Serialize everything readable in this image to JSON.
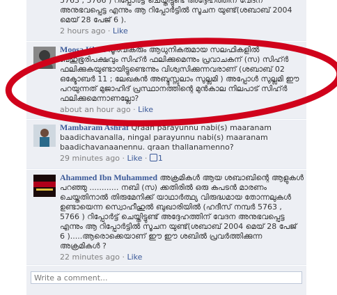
{
  "comments": [
    {
      "author": "",
      "text": "5763 , 5766 ) റിപ്പോർട്ട് ചെയ്തിട്ടുണ്ട് അദ്ദേഹത്തിന് വേദന അനുഭവപ്പെട്ട എന്നും ആ റിപ്പോർട്ടിൽ സൂചന യുണ്ട്(ശബാബ് 2004 മെയ് 28 പേജ് 6 ).",
      "time": "2 hours ago",
      "like_label": "Like"
    },
    {
      "author": "Moosa Khan",
      "text": "പൂർവികരും ആധുനികരുമായ സലഫികളിൽ ബഹുഭൂരിപക്ഷവും സിഹ്ർ ഫലിക്കുമെന്നും പ്രവാചകന് (സ) സിഹ്ർ ഫലിക്കുകയുണ്ടായിട്ടുണ്ടെന്നും വിശ്വസിക്കുന്നവരാണ് (ശബാബ് 02 ഒക്ടോബർ 11 ; ലേഖകൻ അബ്ദുസ്സലാം സുല്ലമി ) അപ്പോൾ സുല്ലമി ഈ പറയുന്നത് മുജാഹിദ് പ്രസ്ഥാനത്തിന്റെ മുൻകാല നിലപാട് സിഹ്ർ ഫലിക്കുമെന്നാണല്ലോ?",
      "time": "about an hour ago",
      "like_label": "Like"
    },
    {
      "author": "Mambaram Ashraf",
      "text": "Qraan parayunnu nabi(s) maaranam baadichavanalla, ningal parayunnu nabi(s) maaranam baadichavanaanennu. qraan thallanamenno?",
      "time": "29 minutes ago",
      "like_label": "Like",
      "likes": "1"
    },
    {
      "author": "Ahammed Ibn Muhammed",
      "text": "അക്രമികൾ ആയ ശബാബിന്റെ ആളുകൾ പറഞ്ഞു ............ നബി (സ) ക്കതിരിൽ ഒരു കപടൻ മാരണം ചെയ്തതിനാൽ തിരുമേനിക്ക് യാഥാർത്ഥ്യ വിരുദ്ധമായ തോന്നലുകൾ ഉണ്ടായെന്ന സ്വൊഹീഹുൽ ബുഖാരിയിൽ (ഹദീസ് നമ്പർ 5763 , 5766 ) റിപ്പോർട്ട് ചെയ്തിട്ടുണ്ട് അദ്ദേഹത്തിന് വേദന അനുഭവപ്പെട്ട എന്നും ആ റിപ്പോർട്ടിൽ സൂചന യുണ്ട്(ശബാബ് 2004 മെയ് 28 പേജ് 6 ).....ആരൊക്കെയാണ് ഈ ഈ ശബിൽ പ്രവർത്തിക്കുന്ന അക്രമികൾ ?",
      "time": "22 minutes ago",
      "like_label": "Like"
    }
  ],
  "write_placeholder": "Write a comment...",
  "separator": "·",
  "colors": {
    "highlight_ellipse": "#d0021b",
    "link": "#3b5998",
    "panel_bg": "#edeff4"
  }
}
